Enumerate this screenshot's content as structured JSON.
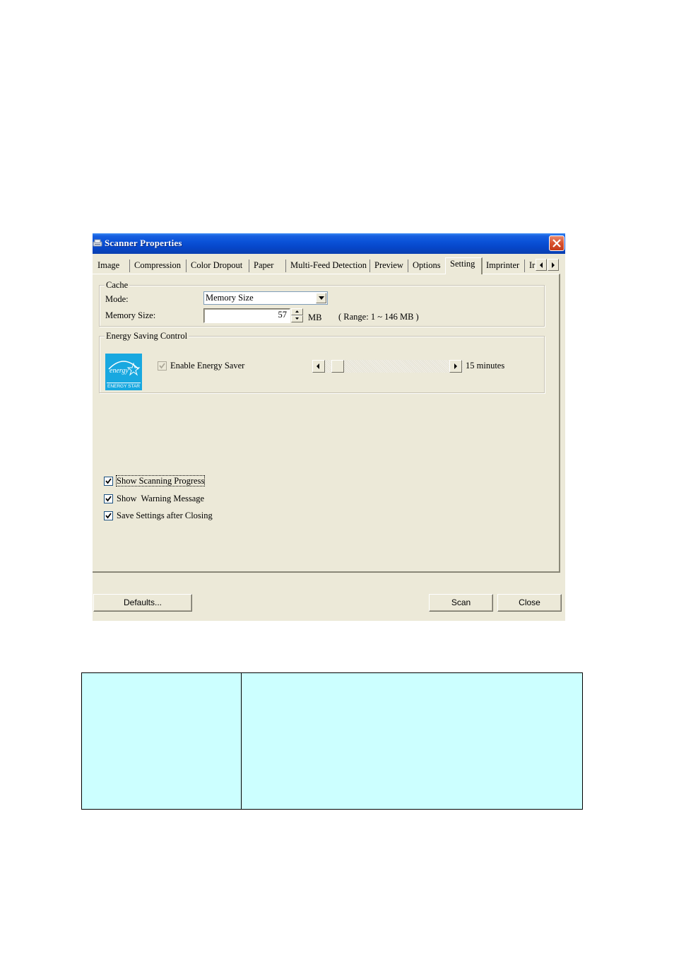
{
  "window": {
    "title": "Scanner Properties",
    "icon": "scanner-icon",
    "close_icon": "close-icon"
  },
  "tabs": [
    {
      "label": "Image",
      "active": false
    },
    {
      "label": "Compression",
      "active": false
    },
    {
      "label": "Color Dropout",
      "active": false
    },
    {
      "label": "Paper",
      "active": false
    },
    {
      "label": "Multi-Feed Detection",
      "active": false
    },
    {
      "label": "Preview",
      "active": false
    },
    {
      "label": "Options",
      "active": false
    },
    {
      "label": "Setting",
      "active": true
    },
    {
      "label": "Imprinter",
      "active": false
    },
    {
      "label": "Ir",
      "active": false
    }
  ],
  "tab_scroll": {
    "left_icon": "arrow-left-icon",
    "right_icon": "arrow-right-icon"
  },
  "cache": {
    "group_label": "Cache",
    "mode_label": "Mode:",
    "mode_value": "Memory Size",
    "memory_label": "Memory Size:",
    "memory_value": "57",
    "memory_unit": "MB",
    "range_text": "( Range: 1 ~ 146 MB )"
  },
  "energy": {
    "group_label": "Energy Saving Control",
    "logo_text": "ENERGY STAR",
    "enable_label": "Enable Energy Saver",
    "enable_checked": true,
    "enable_disabled": true,
    "slider_value_text": "15 minutes",
    "slider_position": 0
  },
  "options": [
    {
      "label": "Show Scanning Progress",
      "checked": true,
      "focused": true
    },
    {
      "label": "Show  Warning Message",
      "checked": true,
      "focused": false
    },
    {
      "label": "Save Settings after Closing",
      "checked": true,
      "focused": false
    }
  ],
  "buttons": {
    "defaults": "Defaults...",
    "scan": "Scan",
    "close": "Close"
  },
  "colors": {
    "dialog_bg": "#ece9d8",
    "titlebar": "#0a52d8",
    "energy_star": "#18a8e0",
    "table_bg": "#ccffff"
  }
}
